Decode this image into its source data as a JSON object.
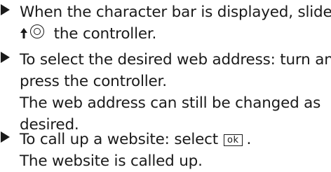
{
  "steps": [
    {
      "line1_before": "When the character bar is displayed, slide",
      "symbol_icon": "controller-slide-up-icon",
      "line2_after": " the controller."
    },
    {
      "line1": "To select the desired web address: turn and",
      "line2": "press the controller.",
      "line3": "The web address can still be changed as",
      "line4": "desired."
    },
    {
      "line1_before": "To call up a website: select",
      "key_label": "ok",
      "line1_after": ".",
      "line2": "The website is called up."
    }
  ]
}
